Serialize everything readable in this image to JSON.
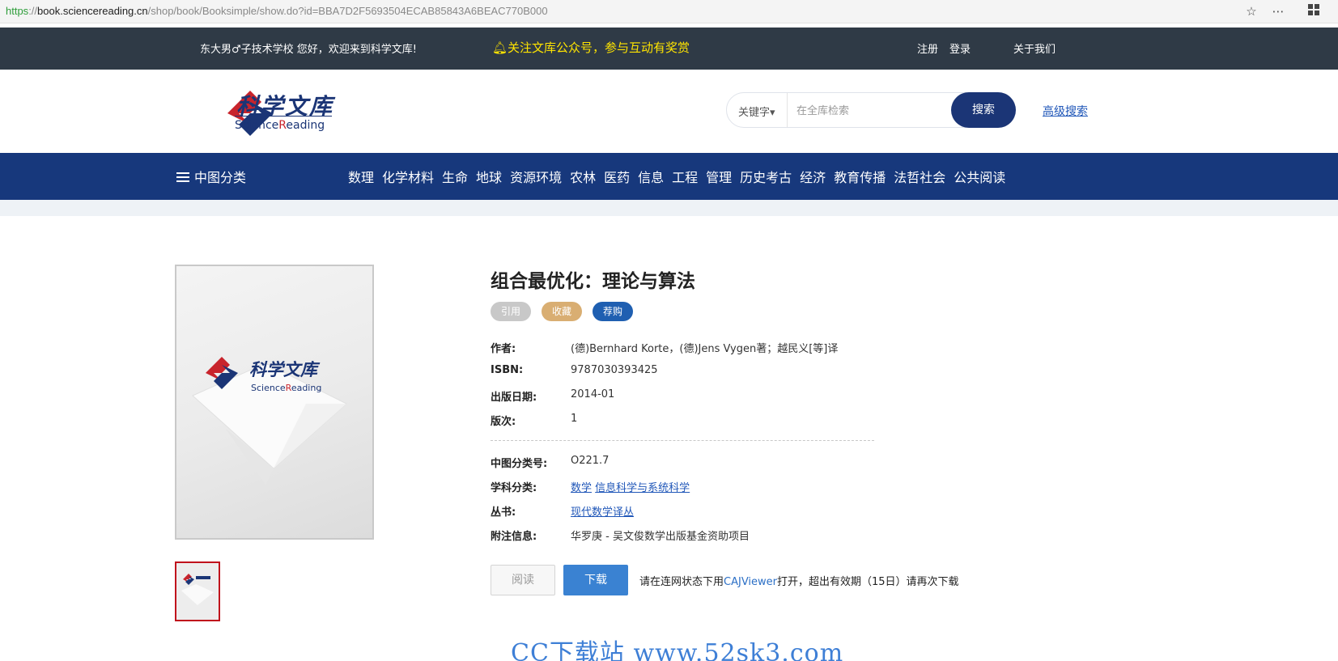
{
  "browser": {
    "url_scheme": "https",
    "url_sep": "://",
    "url_host": "book.sciencereading.cn",
    "url_path": "/shop/book/Booksimple/show.do?id=BBA7D2F5693504ECAB85843A6BEAC770B000",
    "icons": [
      "star-icon",
      "more-icon",
      "apps-icon"
    ]
  },
  "topbar": {
    "welcome": "东大男♂子技术学校 您好，欢迎来到科学文库!",
    "notice": "关注文库公众号，参与互动有奖赏",
    "register": "注册",
    "login": "登录",
    "about": "关于我们"
  },
  "header": {
    "logo_cn": "科学文库",
    "logo_en_a": "Science",
    "logo_en_b": "R",
    "logo_en_c": "eading",
    "search_select": "关键字▾",
    "search_placeholder": "在全库检索",
    "search_button": "搜索",
    "advanced_search": "高级搜索"
  },
  "nav": {
    "category_label": "中图分类",
    "links": [
      "数理",
      "化学材料",
      "生命",
      "地球",
      "资源环境",
      "农林",
      "医药",
      "信息",
      "工程",
      "管理",
      "历史考古",
      "经济",
      "教育传播",
      "法哲社会",
      "公共阅读"
    ]
  },
  "book": {
    "title": "组合最优化：理论与算法",
    "actions": {
      "cite": "引用",
      "favorite": "收藏",
      "recommend": "荐购"
    },
    "author_label": "作者:",
    "author": "(德)Bernhard Korte，(德)Jens Vygen著；越民义[等]译",
    "isbn_label": "ISBN:",
    "isbn": "9787030393425",
    "pubdate_label": "出版日期:",
    "pubdate": "2014-01",
    "edition_label": "版次:",
    "edition": "1",
    "clc_label": "中图分类号:",
    "clc": "O221.7",
    "subject_label": "学科分类:",
    "subjects": [
      "数学",
      "信息科学与系统科学"
    ],
    "series_label": "丛书:",
    "series": "现代数学译丛",
    "note_label": "附注信息:",
    "note": "华罗庚 - 吴文俊数学出版基金资助项目",
    "read_button": "阅读",
    "download_button": "下载",
    "download_note_a": "请在连网状态下用",
    "download_note_link": "CAJViewer",
    "download_note_b": "打开，超出有效期（15日）请再次下载"
  },
  "watermark": "CC下载站 www.52sk3.com"
}
